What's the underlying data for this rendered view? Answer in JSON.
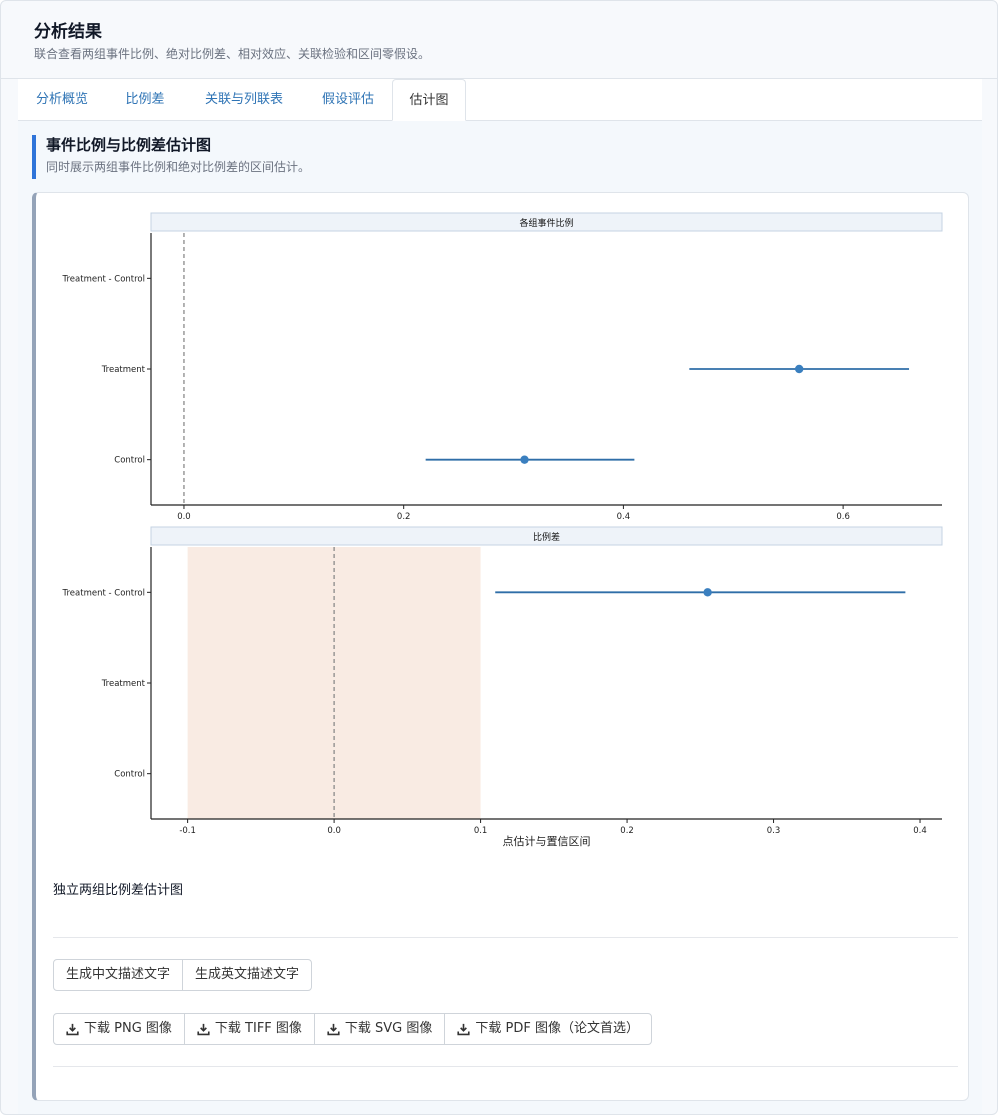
{
  "header": {
    "title": "分析结果",
    "subtitle": "联合查看两组事件比例、绝对比例差、相对效应、关联检验和区间零假设。"
  },
  "tabs": [
    {
      "label": "分析概览"
    },
    {
      "label": "比例差"
    },
    {
      "label": "关联与列联表"
    },
    {
      "label": "假设评估"
    },
    {
      "label": "估计图"
    }
  ],
  "active_tab": "估计图",
  "section": {
    "title": "事件比例与比例差估计图",
    "subtitle": "同时展示两组事件比例和绝对比例差的区间估计。"
  },
  "chart_data": {
    "type": "scatter",
    "subtype": "forest",
    "xlabel": "点估计与置信区间",
    "categories": [
      "Treatment - Control",
      "Treatment",
      "Control"
    ],
    "line_color": "#2f6ea8",
    "point_color": "#3a7fbf",
    "band_color": "#f9ebe3",
    "panels": [
      {
        "strip": "各组事件比例",
        "xlim": [
          -0.03,
          0.69
        ],
        "xticks": [
          0.0,
          0.2,
          0.4,
          0.6
        ],
        "xtick_labels": [
          "0.0",
          "0.2",
          "0.4",
          "0.6"
        ],
        "reference_line": 0.0,
        "points": [
          {
            "category": "Treatment",
            "estimate": 0.56,
            "lower": 0.46,
            "upper": 0.66
          },
          {
            "category": "Control",
            "estimate": 0.31,
            "lower": 0.22,
            "upper": 0.41
          }
        ]
      },
      {
        "strip": "比例差",
        "xlim": [
          -0.125,
          0.415
        ],
        "xticks": [
          -0.1,
          0.0,
          0.1,
          0.2,
          0.3,
          0.4
        ],
        "xtick_labels": [
          "-0.1",
          "0.0",
          "0.1",
          "0.2",
          "0.3",
          "0.4"
        ],
        "reference_line": 0.0,
        "equivalence_band": [
          -0.1,
          0.1
        ],
        "points": [
          {
            "category": "Treatment - Control",
            "estimate": 0.255,
            "lower": 0.11,
            "upper": 0.39
          }
        ]
      }
    ]
  },
  "caption": "独立两组比例差估计图",
  "buttons": {
    "describe_cn": "生成中文描述文字",
    "describe_en": "生成英文描述文字",
    "dl_png": "下载 PNG 图像",
    "dl_tiff": "下载 TIFF 图像",
    "dl_svg": "下载 SVG 图像",
    "dl_pdf": "下载 PDF 图像（论文首选）",
    "download_icon": "download-icon"
  }
}
